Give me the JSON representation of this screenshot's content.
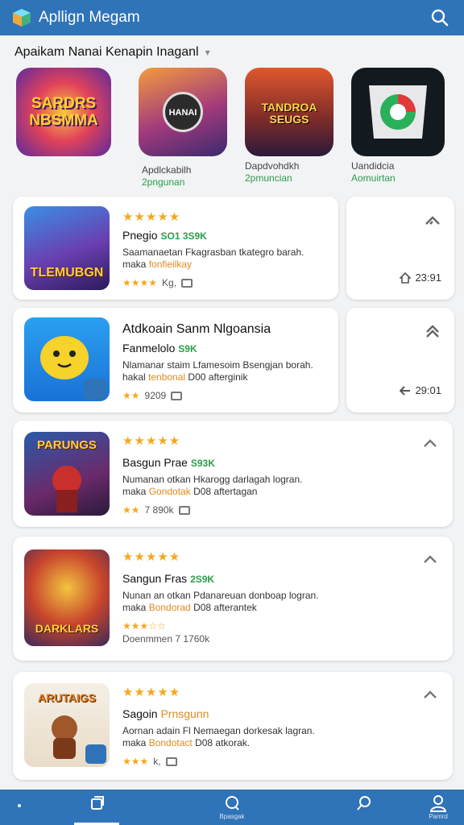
{
  "header": {
    "title": "Apllign Megam",
    "logo_icon": "cube-logo-icon",
    "search_icon": "search-icon"
  },
  "section": {
    "title": "Apaikam Nanai Kenapin Inaganl",
    "chevron": "▾"
  },
  "featured": [
    {
      "art": "SARDRS\nNBSMMA",
      "name": "Apdlckabilh",
      "sub": "2pngunan"
    },
    {
      "art": "HANAI",
      "name": "",
      "sub": ""
    },
    {
      "art": "TANDROA\nSEUGS",
      "name": "Dapdvohdkh",
      "sub": "2pmuncian"
    },
    {
      "art": "",
      "name": "Uandidcia",
      "sub": "Aomuirtan"
    }
  ],
  "cards": [
    {
      "stars": "★★★★★",
      "title": "Pnegio",
      "tag": "SO1 3S9K",
      "desc1": "Saamanaetan Fkagrasban tkategro barah.",
      "desc2a": "maka",
      "desc2b": "fonfieilkay",
      "desc2c": "",
      "meta_stars": "★★★★",
      "meta": "Kg,",
      "icon_art": "TLEMUBGN",
      "side_count": "23:91"
    },
    {
      "big": "Atdkoain Sanm Nlgoansia",
      "title": "Fanmelolo",
      "tag": "S9K",
      "desc1": "Nlamanar staim Lfamesoim Bsengjan borah.",
      "desc2a": "hakal",
      "desc2b": "tenbonal",
      "desc2c": "D00 afterginik",
      "meta_stars": "★★",
      "meta": "9209",
      "side_count": "29:01"
    },
    {
      "stars": "★★★★★",
      "title": "Basgun Prae",
      "tag": "S93K",
      "desc1": "Numanan otkan Hkarogg darlagah logran.",
      "desc2a": "maka",
      "desc2b": "Gondotak",
      "desc2c": "D08 aftertagan",
      "meta_stars": "★★",
      "meta": "7 890k",
      "icon_art": "PARUNGS"
    },
    {
      "stars": "★★★★★",
      "title": "Sangun Fras",
      "tag": "2S9K",
      "desc1": "Nunan an otkan Pdanareuan donboap logran.",
      "desc2a": "maka",
      "desc2b": "Bondorad",
      "desc2c": "D08 afterantek",
      "meta_stars": "★★★☆☆",
      "meta": "Doenmmen 7 1760k",
      "icon_art": "DARKLARS"
    },
    {
      "stars": "★★★★★",
      "title": "Sagoin",
      "tag": "Prnsgunn",
      "desc1": "Aornan adain Fl Nemaegan dorkesak lagran.",
      "desc2a": "maka",
      "desc2b": "Bondotact",
      "desc2c": "D08 atkorak.",
      "meta_stars": "★★★",
      "meta": "k,",
      "icon_art": "ARUTAIGS"
    }
  ],
  "bottom_nav": [
    {
      "icon": "dot-icon",
      "label": ""
    },
    {
      "icon": "library-icon",
      "label": ""
    },
    {
      "icon": "search-icon",
      "label": "Bpasgak"
    },
    {
      "icon": "explore-icon",
      "label": ""
    },
    {
      "icon": "profile-icon",
      "label": "Pamrd"
    }
  ],
  "colors": {
    "brand": "#2f73b8",
    "star": "#f4a81d",
    "accent_green": "#2a9d4a"
  }
}
